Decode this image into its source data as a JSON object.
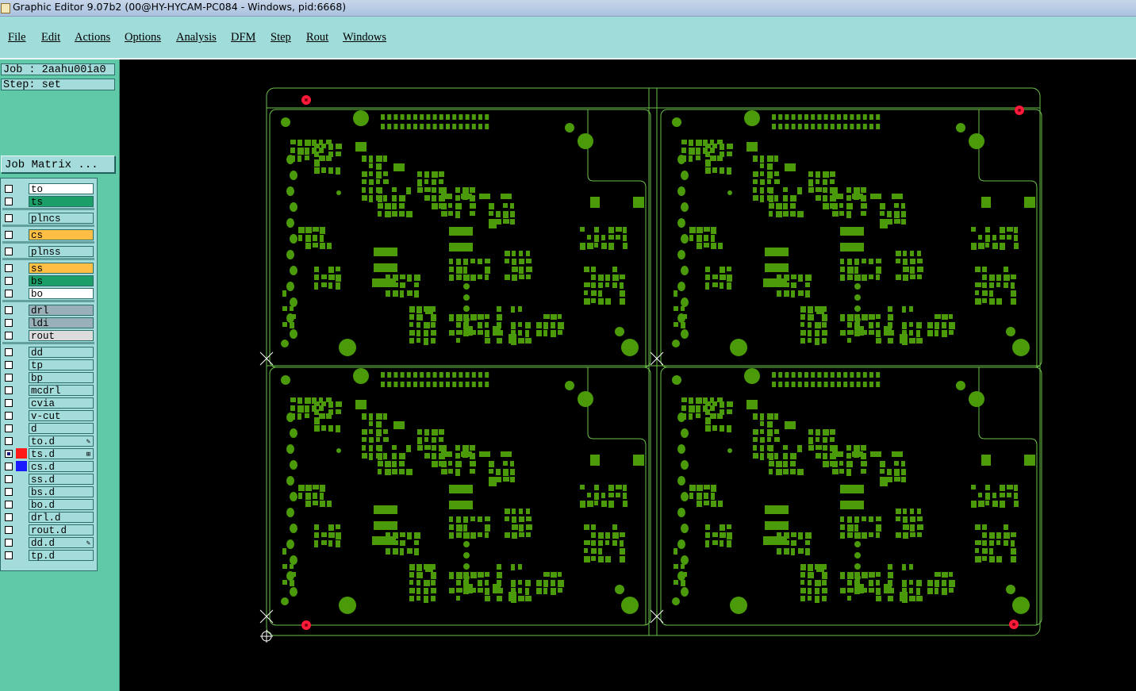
{
  "window": {
    "title": "Graphic Editor 9.07b2 (00@HY-HYCAM-PC084 - Windows, pid:6668)"
  },
  "menu": [
    {
      "id": "file",
      "label": "File"
    },
    {
      "id": "edit",
      "label": "Edit"
    },
    {
      "id": "actions",
      "label": "Actions"
    },
    {
      "id": "options",
      "label": "Options"
    },
    {
      "id": "analysis",
      "label": "Analysis"
    },
    {
      "id": "dfm",
      "label": "DFM"
    },
    {
      "id": "step",
      "label": "Step"
    },
    {
      "id": "rout",
      "label": "Rout"
    },
    {
      "id": "windows",
      "label": "Windows"
    }
  ],
  "job": {
    "job_label": "Job : 2aahu00ia0",
    "step_label": "Step: set",
    "job_matrix_button": "Job Matrix ..."
  },
  "layers": [
    {
      "name": "to",
      "color": "#ffffff",
      "swatch": "",
      "checked": false
    },
    {
      "name": "ts",
      "color": "#1b9e68",
      "swatch": "",
      "checked": false
    },
    {
      "name": "plncs",
      "color": "#a3dcda",
      "swatch": "",
      "checked": false
    },
    {
      "name": "cs",
      "color": "#ffbf44",
      "swatch": "",
      "checked": false
    },
    {
      "name": "plnss",
      "color": "#a3dcda",
      "swatch": "",
      "checked": false
    },
    {
      "name": "ss",
      "color": "#ffbf44",
      "swatch": "",
      "checked": false
    },
    {
      "name": "bs",
      "color": "#1b9e68",
      "swatch": "",
      "checked": false
    },
    {
      "name": "bo",
      "color": "#ffffff",
      "swatch": "",
      "checked": false
    },
    {
      "name": "drl",
      "color": "#9ab0b8",
      "swatch": "",
      "checked": false
    },
    {
      "name": "ldi",
      "color": "#9ab0b8",
      "swatch": "",
      "checked": false
    },
    {
      "name": "rout",
      "color": "#dcdcdc",
      "swatch": "",
      "checked": false
    },
    {
      "name": "dd",
      "color": "#a3dcda",
      "swatch": "",
      "checked": false
    },
    {
      "name": "tp",
      "color": "#a3dcda",
      "swatch": "",
      "checked": false
    },
    {
      "name": "bp",
      "color": "#a3dcda",
      "swatch": "",
      "checked": false
    },
    {
      "name": "mcdrl",
      "color": "#a3dcda",
      "swatch": "",
      "checked": false
    },
    {
      "name": "cvia",
      "color": "#a3dcda",
      "swatch": "",
      "checked": false
    },
    {
      "name": "v-cut",
      "color": "#a3dcda",
      "swatch": "",
      "checked": false
    },
    {
      "name": "d",
      "color": "#a3dcda",
      "swatch": "",
      "checked": false
    },
    {
      "name": "to.d",
      "color": "#a3dcda",
      "swatch": "",
      "checked": false,
      "mark": "pencil"
    },
    {
      "name": "ts.d",
      "color": "#a3dcda",
      "swatch": "#ff1a1a",
      "checked": true,
      "mark": "grid"
    },
    {
      "name": "cs.d",
      "color": "#a3dcda",
      "swatch": "#1a1aff",
      "checked": false
    },
    {
      "name": "ss.d",
      "color": "#a3dcda",
      "swatch": "",
      "checked": false
    },
    {
      "name": "bs.d",
      "color": "#a3dcda",
      "swatch": "",
      "checked": false
    },
    {
      "name": "bo.d",
      "color": "#a3dcda",
      "swatch": "",
      "checked": false
    },
    {
      "name": "drl.d",
      "color": "#a3dcda",
      "swatch": "",
      "checked": false
    },
    {
      "name": "rout.d",
      "color": "#a3dcda",
      "swatch": "",
      "checked": false
    },
    {
      "name": "dd.d",
      "color": "#a3dcda",
      "swatch": "",
      "checked": false,
      "mark": "pencil"
    },
    {
      "name": "tp.d",
      "color": "#a3dcda",
      "swatch": "",
      "checked": false
    }
  ],
  "colors": {
    "pcb_green": "#4a9a0a",
    "outline": "#6cc24a",
    "fiducial": "#ff1a3a",
    "canvas_bg": "#000000"
  }
}
